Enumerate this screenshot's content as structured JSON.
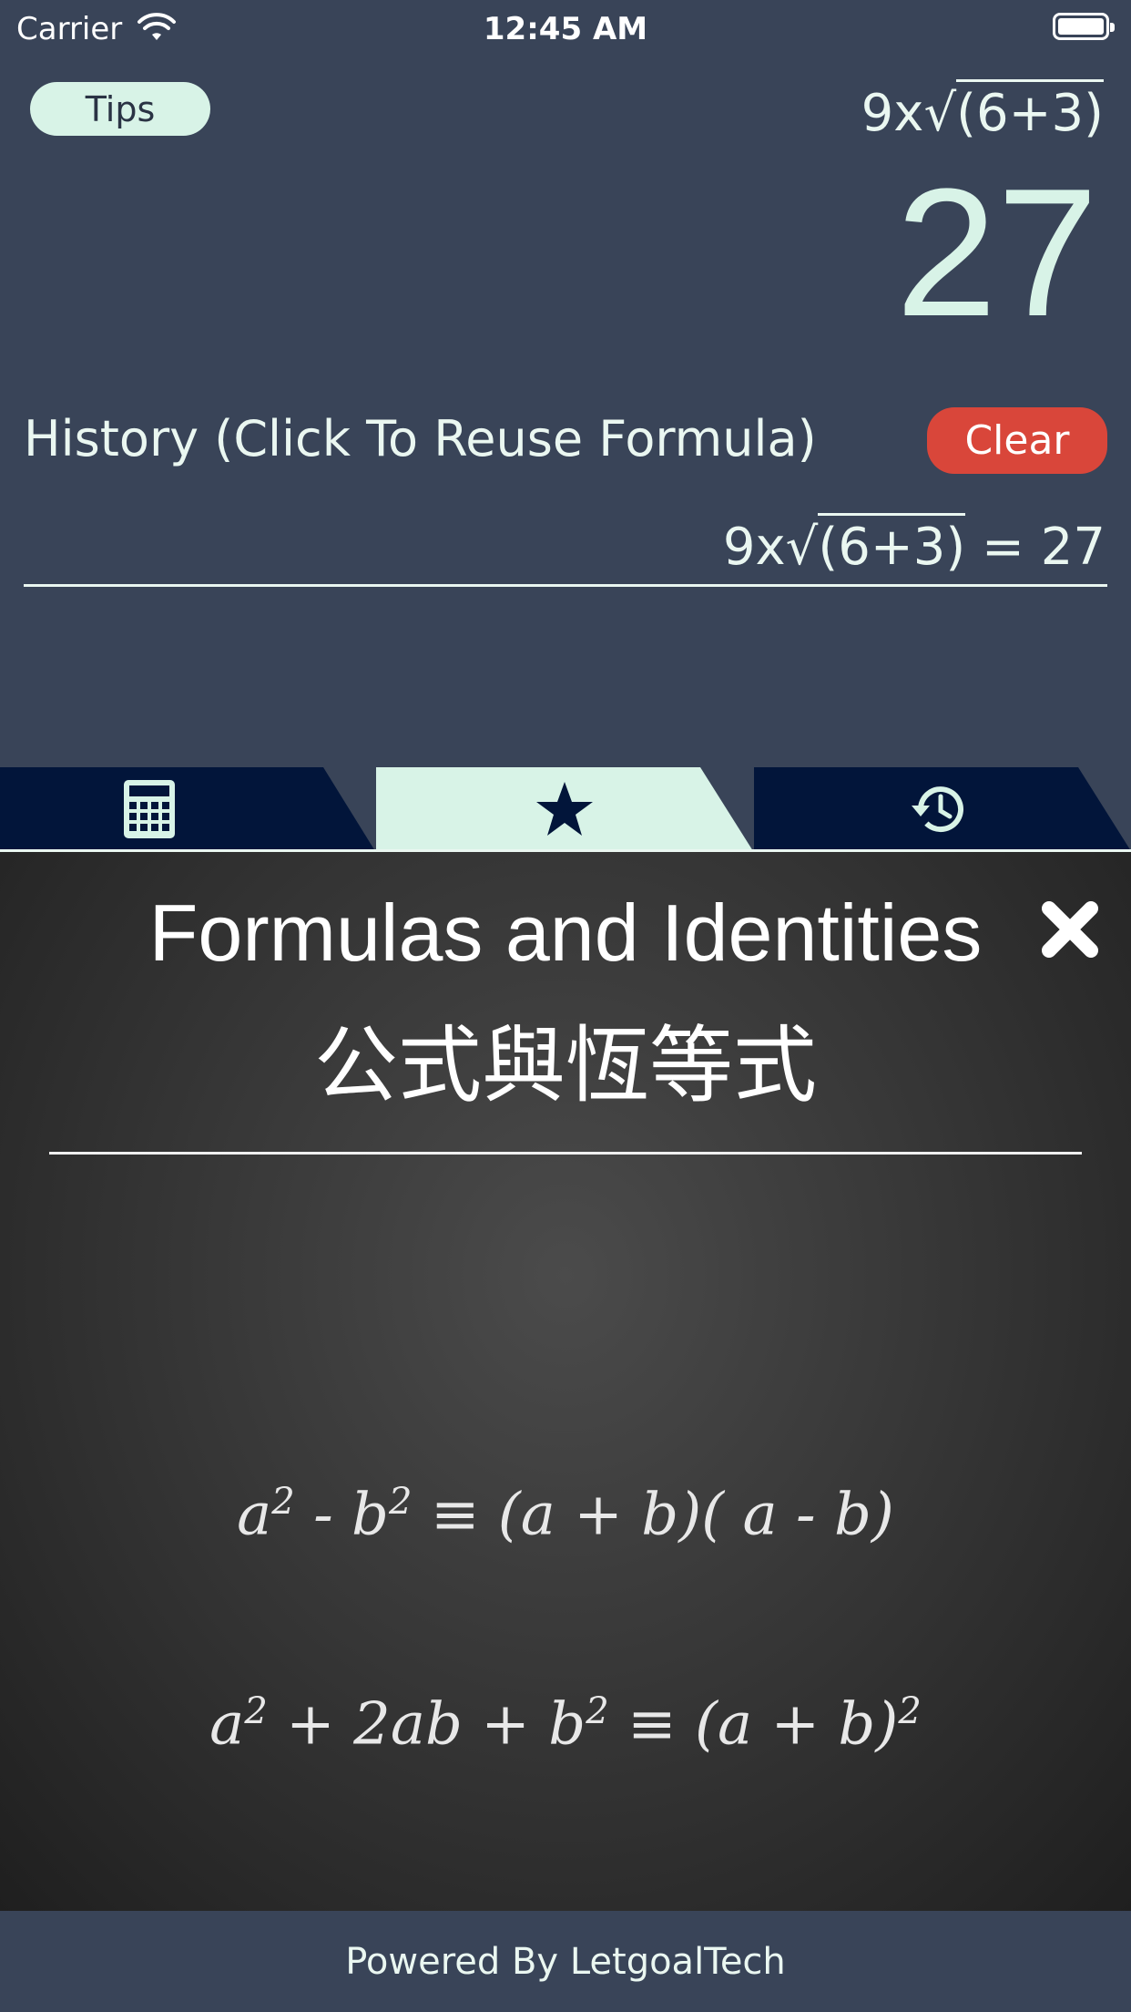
{
  "status_bar": {
    "carrier": "Carrier",
    "time": "12:45 AM"
  },
  "calculator": {
    "tips_label": "Tips",
    "formula_prefix": "9x√",
    "formula_arg": "(6+3)",
    "result": "27"
  },
  "history": {
    "label": "History (Click To Reuse Formula)",
    "clear_label": "Clear",
    "items": [
      {
        "prefix": "9x√",
        "arg": "(6+3)",
        "suffix": " = 27"
      }
    ]
  },
  "tabs": [
    {
      "icon": "calculator-icon",
      "active": false
    },
    {
      "icon": "star-icon",
      "active": true
    },
    {
      "icon": "history-icon",
      "active": false
    }
  ],
  "panel": {
    "title": "Formulas and Identities",
    "subtitle": "公式與恆等式",
    "formulas": [
      {
        "a": "a",
        "p1": "2",
        "b": " - b",
        "p2": "2",
        "c": " ≡ (a + b)( a - b)",
        "p3": ""
      },
      {
        "a": "a",
        "p1": "2",
        "b": " + 2ab + b",
        "p2": "2",
        "c": " ≡ (a + b)",
        "p3": "2"
      }
    ]
  },
  "colors": {
    "background": "#394458",
    "accent_mint": "#d8f3e7",
    "clear_red": "#d9463a",
    "tab_navy": "#02153a"
  },
  "footer": {
    "text": "Powered By LetgoalTech"
  }
}
